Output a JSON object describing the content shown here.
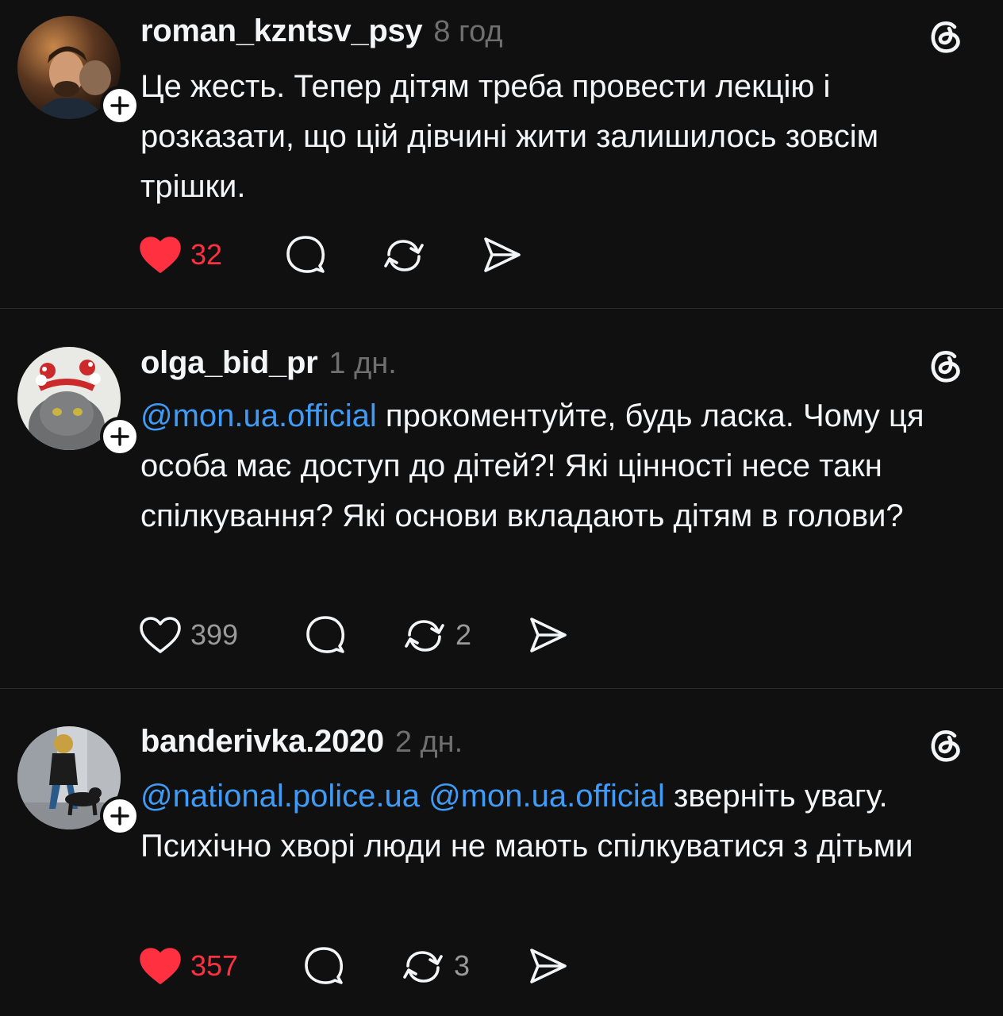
{
  "posts": [
    {
      "username": "roman_kzntsv_psy",
      "time": "8 год",
      "text_segments": [
        {
          "text": "Це жесть. Тепер дітям треба провести лекцію і розказати, що цій дівчині жити залишилось зовсім трішки.",
          "mention": false
        }
      ],
      "liked": true,
      "like_count": "32",
      "reply_count": "",
      "repost_count": ""
    },
    {
      "username": "olga_bid_pr",
      "time": "1 дн.",
      "text_segments": [
        {
          "text": "@mon.ua.official",
          "mention": true
        },
        {
          "text": " прокоментуйте, будь ласка. Чому ця особа має доступ до дітей?! Які цінності несе такн спілкування? Які основи вкладають дітям в голови?",
          "mention": false
        }
      ],
      "liked": false,
      "like_count": "399",
      "reply_count": "",
      "repost_count": "2"
    },
    {
      "username": "banderivka.2020",
      "time": "2 дн.",
      "text_segments": [
        {
          "text": "@national.police.ua",
          "mention": true
        },
        {
          "text": " ",
          "mention": false
        },
        {
          "text": "@mon.ua.official",
          "mention": true
        },
        {
          "text": " зверніть увагу. Психічно хворі люди не мають спілкуватися з дітьми",
          "mention": false
        }
      ],
      "liked": true,
      "like_count": "357",
      "reply_count": "",
      "repost_count": "3"
    }
  ],
  "icons": {
    "like": "heart-icon",
    "reply": "comment-bubble-icon",
    "repost": "repost-icon",
    "share": "send-icon",
    "follow": "plus-icon",
    "brand": "threads-logo-icon"
  },
  "colors": {
    "background": "#101010",
    "text": "#f3f5f7",
    "secondary": "#9a9a9a",
    "mention": "#3f9bf5",
    "like_active": "#ff3040"
  }
}
